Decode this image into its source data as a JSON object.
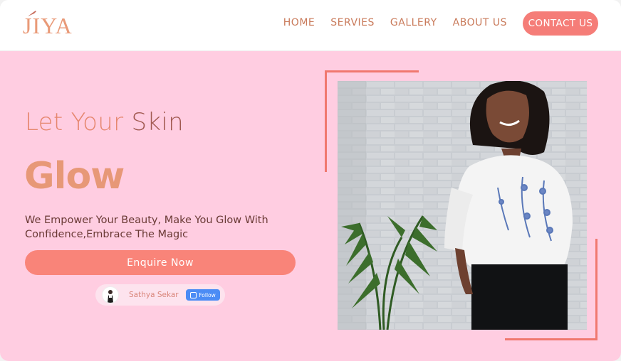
{
  "brand": {
    "logo_text": "JIYA",
    "accent": "#f57d78",
    "hero_bg": "#ffcde1"
  },
  "nav": {
    "items": [
      "HOME",
      "SERVIES",
      "GALLERY",
      "ABOUT US"
    ],
    "contact_label": "CONTACT US"
  },
  "hero": {
    "headline_part1": "Let Your ",
    "headline_part2": "Skin",
    "headline_big": "Glow",
    "description": "We Empower Your Beauty, Make You Glow With Confidence,Embrace The Magic",
    "cta_label": "Enquire Now"
  },
  "profile_badge": {
    "name": "Sathya Sekar",
    "follow_label": "Follow",
    "follow_icon": "instagram-icon"
  },
  "image": {
    "alt": "woman-in-white-embroidered-top"
  }
}
